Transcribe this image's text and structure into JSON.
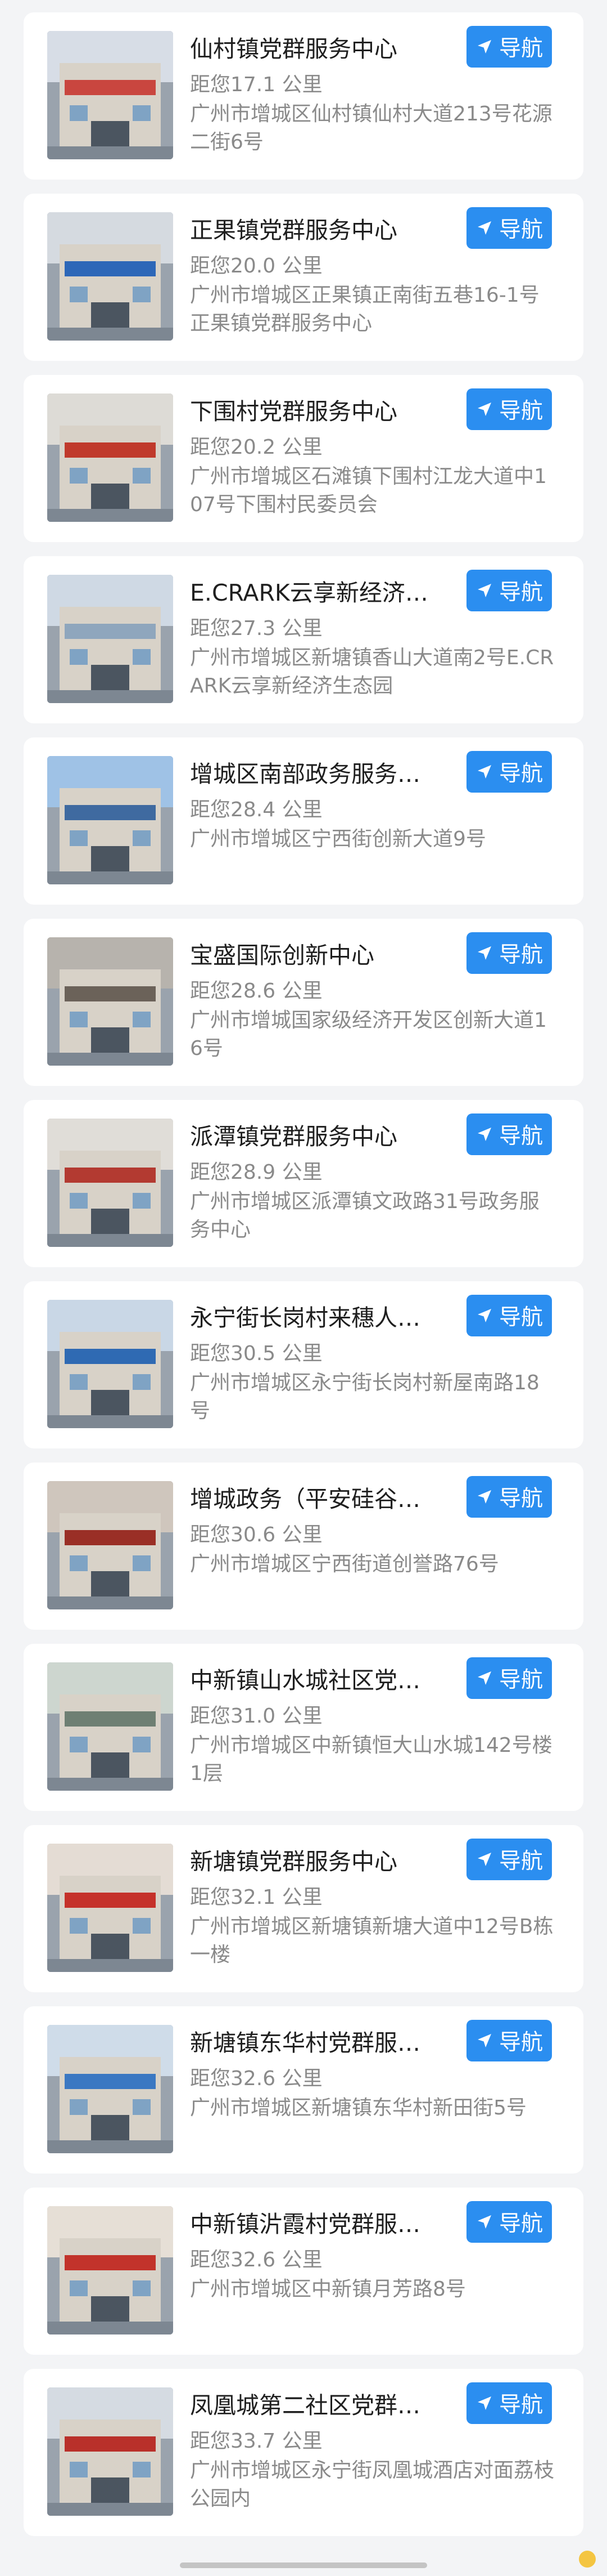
{
  "nav_label": "导航",
  "items": [
    {
      "title": "仙村镇党群服务中心",
      "distance": "距您17.1 公里",
      "address": "广州市增城区仙村镇仙村大道213号花源二街6号"
    },
    {
      "title": "正果镇党群服务中心",
      "distance": "距您20.0 公里",
      "address": "广州市增城区正果镇正南街五巷16-1号正果镇党群服务中心"
    },
    {
      "title": "下围村党群服务中心",
      "distance": "距您20.2 公里",
      "address": "广州市增城区石滩镇下围村江龙大道中107号下围村民委员会"
    },
    {
      "title": "E.CRARK云享新经济…",
      "distance": "距您27.3 公里",
      "address": "广州市增城区新塘镇香山大道南2号E.CRARK云享新经济生态园"
    },
    {
      "title": "增城区南部政务服务…",
      "distance": "距您28.4 公里",
      "address": "广州市增城区宁西街创新大道9号"
    },
    {
      "title": "宝盛国际创新中心",
      "distance": "距您28.6 公里",
      "address": "广州市增城国家级经济开发区创新大道16号"
    },
    {
      "title": "派潭镇党群服务中心",
      "distance": "距您28.9 公里",
      "address": "广州市增城区派潭镇文政路31号政务服务中心"
    },
    {
      "title": "永宁街长岗村来穗人…",
      "distance": "距您30.5 公里",
      "address": "广州市增城区永宁街长岗村新屋南路18号"
    },
    {
      "title": "增城政务（平安硅谷…",
      "distance": "距您30.6 公里",
      "address": "广州市增城区宁西街道创誉路76号"
    },
    {
      "title": "中新镇山水城社区党…",
      "distance": "距您31.0 公里",
      "address": "广州市增城区中新镇恒大山水城142号楼1层"
    },
    {
      "title": "新塘镇党群服务中心",
      "distance": "距您32.1 公里",
      "address": "广州市增城区新塘镇新塘大道中12号B栋一楼"
    },
    {
      "title": "新塘镇东华村党群服…",
      "distance": "距您32.6 公里",
      "address": "广州市增城区新塘镇东华村新田街5号"
    },
    {
      "title": "中新镇沜霞村党群服…",
      "distance": "距您32.6 公里",
      "address": "广州市增城区中新镇月芳路8号"
    },
    {
      "title": "凤凰城第二社区党群…",
      "distance": "距您33.7 公里",
      "address": "广州市增城区永宁街凤凰城酒店对面荔枝公园内"
    }
  ],
  "colors": {
    "nav_button": "#2b8ef0",
    "background": "#f3f4f6",
    "card": "#ffffff"
  }
}
